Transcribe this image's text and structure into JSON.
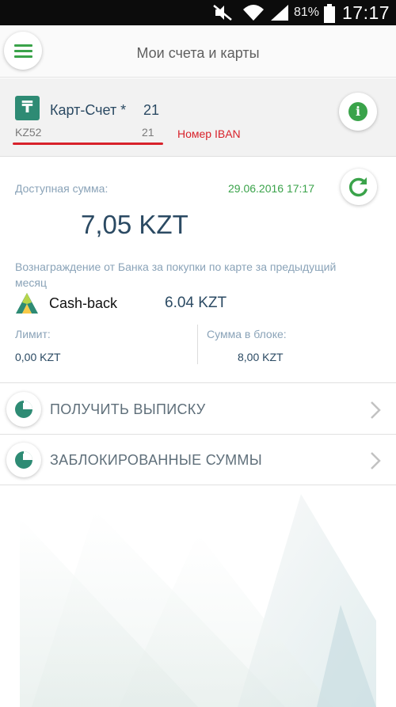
{
  "status_bar": {
    "battery": "81%",
    "time": "17:17"
  },
  "header": {
    "title": "Мои счета и карты"
  },
  "account": {
    "logo_glyph": "₸",
    "name": "Карт-Счет *",
    "number_suffix": "21",
    "iban_prefix": "KZ52",
    "iban_suffix": "21",
    "iban_annotation": "Номер IBAN"
  },
  "balance": {
    "available_label": "Доступная сумма:",
    "date": "29.06.2016 17:17",
    "amount": "7,05 KZT",
    "reward_text": "Вознаграждение от Банка за покупки по карте за предыдущий месяц",
    "cashback_label": "Cash-back",
    "cashback_value": "6.04 KZT",
    "limit_label": "Лимит:",
    "limit_value": "0,00 KZT",
    "blocked_label": "Сумма в блоке:",
    "blocked_value": "8,00 KZT"
  },
  "actions": {
    "statement": "ПОЛУЧИТЬ ВЫПИСКУ",
    "blocked_sums": "ЗАБЛОКИРОВАННЫЕ СУММЫ"
  },
  "colors": {
    "accent_green": "#3aa34a",
    "brand_teal": "#2e8b74",
    "annotation_red": "#d8222b",
    "text_dark": "#2b4a63",
    "text_muted": "#8aa3b8"
  }
}
